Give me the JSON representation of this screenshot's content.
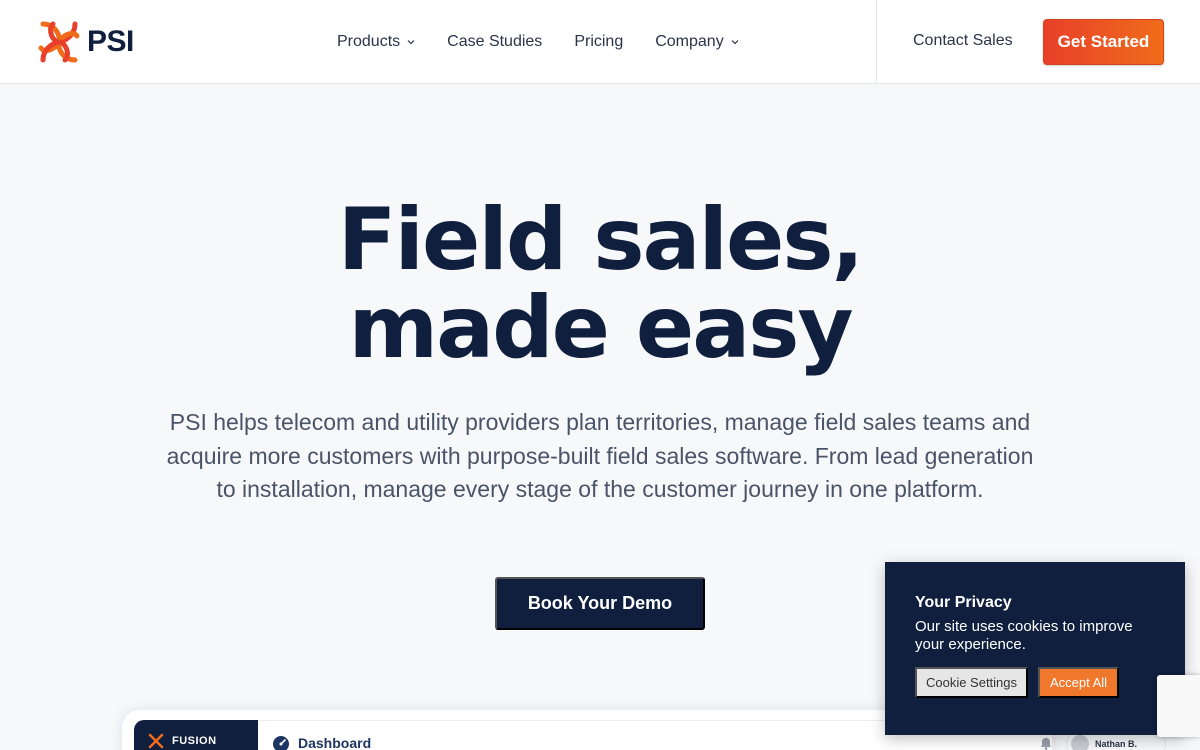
{
  "brand": {
    "name": "PSI",
    "accent": "#f06c1a",
    "primary": "#0f1f3d"
  },
  "nav": {
    "items": [
      {
        "label": "Products",
        "has_dropdown": true
      },
      {
        "label": "Case Studies",
        "has_dropdown": false
      },
      {
        "label": "Pricing",
        "has_dropdown": false
      },
      {
        "label": "Company",
        "has_dropdown": true
      }
    ],
    "contact_sales": "Contact Sales",
    "get_started": "Get Started"
  },
  "hero": {
    "title_line1": "Field sales,",
    "title_line2": "made easy",
    "subtitle": "PSI helps telecom and utility providers plan territories, manage field sales teams and acquire more customers with purpose-built field sales software. From lead generation to installation, manage every stage of the customer journey in one platform.",
    "cta": "Book Your Demo"
  },
  "preview": {
    "app_name": "FUSION",
    "page_title": "Dashboard",
    "user_name": "Nathan B."
  },
  "cookie": {
    "title": "Your Privacy",
    "text": "Our site uses cookies to improve your experience.",
    "settings_label": "Cookie Settings",
    "accept_label": "Accept All"
  }
}
